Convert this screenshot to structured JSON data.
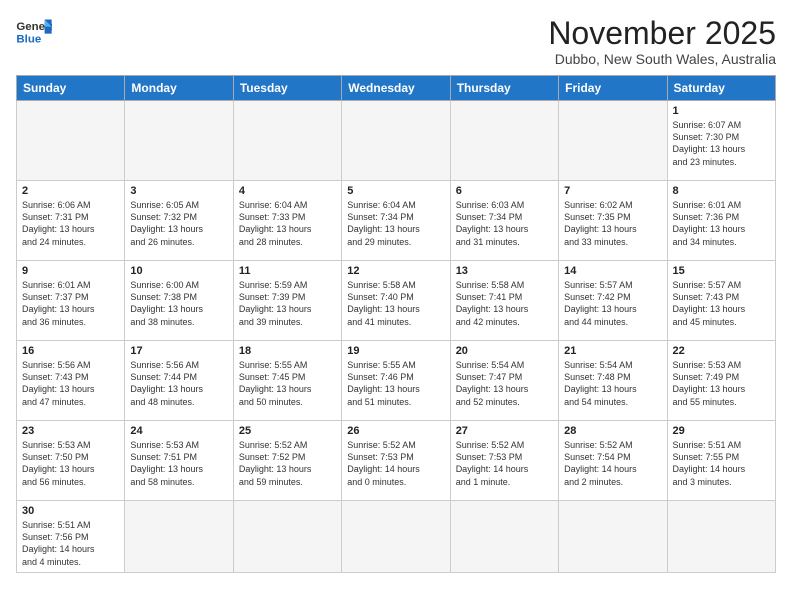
{
  "header": {
    "logo_line1": "General",
    "logo_line2": "Blue",
    "month_title": "November 2025",
    "location": "Dubbo, New South Wales, Australia"
  },
  "weekdays": [
    "Sunday",
    "Monday",
    "Tuesday",
    "Wednesday",
    "Thursday",
    "Friday",
    "Saturday"
  ],
  "weeks": [
    [
      {
        "day": "",
        "info": ""
      },
      {
        "day": "",
        "info": ""
      },
      {
        "day": "",
        "info": ""
      },
      {
        "day": "",
        "info": ""
      },
      {
        "day": "",
        "info": ""
      },
      {
        "day": "",
        "info": ""
      },
      {
        "day": "1",
        "info": "Sunrise: 6:07 AM\nSunset: 7:30 PM\nDaylight: 13 hours\nand 23 minutes."
      }
    ],
    [
      {
        "day": "2",
        "info": "Sunrise: 6:06 AM\nSunset: 7:31 PM\nDaylight: 13 hours\nand 24 minutes."
      },
      {
        "day": "3",
        "info": "Sunrise: 6:05 AM\nSunset: 7:32 PM\nDaylight: 13 hours\nand 26 minutes."
      },
      {
        "day": "4",
        "info": "Sunrise: 6:04 AM\nSunset: 7:33 PM\nDaylight: 13 hours\nand 28 minutes."
      },
      {
        "day": "5",
        "info": "Sunrise: 6:04 AM\nSunset: 7:34 PM\nDaylight: 13 hours\nand 29 minutes."
      },
      {
        "day": "6",
        "info": "Sunrise: 6:03 AM\nSunset: 7:34 PM\nDaylight: 13 hours\nand 31 minutes."
      },
      {
        "day": "7",
        "info": "Sunrise: 6:02 AM\nSunset: 7:35 PM\nDaylight: 13 hours\nand 33 minutes."
      },
      {
        "day": "8",
        "info": "Sunrise: 6:01 AM\nSunset: 7:36 PM\nDaylight: 13 hours\nand 34 minutes."
      }
    ],
    [
      {
        "day": "9",
        "info": "Sunrise: 6:01 AM\nSunset: 7:37 PM\nDaylight: 13 hours\nand 36 minutes."
      },
      {
        "day": "10",
        "info": "Sunrise: 6:00 AM\nSunset: 7:38 PM\nDaylight: 13 hours\nand 38 minutes."
      },
      {
        "day": "11",
        "info": "Sunrise: 5:59 AM\nSunset: 7:39 PM\nDaylight: 13 hours\nand 39 minutes."
      },
      {
        "day": "12",
        "info": "Sunrise: 5:58 AM\nSunset: 7:40 PM\nDaylight: 13 hours\nand 41 minutes."
      },
      {
        "day": "13",
        "info": "Sunrise: 5:58 AM\nSunset: 7:41 PM\nDaylight: 13 hours\nand 42 minutes."
      },
      {
        "day": "14",
        "info": "Sunrise: 5:57 AM\nSunset: 7:42 PM\nDaylight: 13 hours\nand 44 minutes."
      },
      {
        "day": "15",
        "info": "Sunrise: 5:57 AM\nSunset: 7:43 PM\nDaylight: 13 hours\nand 45 minutes."
      }
    ],
    [
      {
        "day": "16",
        "info": "Sunrise: 5:56 AM\nSunset: 7:43 PM\nDaylight: 13 hours\nand 47 minutes."
      },
      {
        "day": "17",
        "info": "Sunrise: 5:56 AM\nSunset: 7:44 PM\nDaylight: 13 hours\nand 48 minutes."
      },
      {
        "day": "18",
        "info": "Sunrise: 5:55 AM\nSunset: 7:45 PM\nDaylight: 13 hours\nand 50 minutes."
      },
      {
        "day": "19",
        "info": "Sunrise: 5:55 AM\nSunset: 7:46 PM\nDaylight: 13 hours\nand 51 minutes."
      },
      {
        "day": "20",
        "info": "Sunrise: 5:54 AM\nSunset: 7:47 PM\nDaylight: 13 hours\nand 52 minutes."
      },
      {
        "day": "21",
        "info": "Sunrise: 5:54 AM\nSunset: 7:48 PM\nDaylight: 13 hours\nand 54 minutes."
      },
      {
        "day": "22",
        "info": "Sunrise: 5:53 AM\nSunset: 7:49 PM\nDaylight: 13 hours\nand 55 minutes."
      }
    ],
    [
      {
        "day": "23",
        "info": "Sunrise: 5:53 AM\nSunset: 7:50 PM\nDaylight: 13 hours\nand 56 minutes."
      },
      {
        "day": "24",
        "info": "Sunrise: 5:53 AM\nSunset: 7:51 PM\nDaylight: 13 hours\nand 58 minutes."
      },
      {
        "day": "25",
        "info": "Sunrise: 5:52 AM\nSunset: 7:52 PM\nDaylight: 13 hours\nand 59 minutes."
      },
      {
        "day": "26",
        "info": "Sunrise: 5:52 AM\nSunset: 7:53 PM\nDaylight: 14 hours\nand 0 minutes."
      },
      {
        "day": "27",
        "info": "Sunrise: 5:52 AM\nSunset: 7:53 PM\nDaylight: 14 hours\nand 1 minute."
      },
      {
        "day": "28",
        "info": "Sunrise: 5:52 AM\nSunset: 7:54 PM\nDaylight: 14 hours\nand 2 minutes."
      },
      {
        "day": "29",
        "info": "Sunrise: 5:51 AM\nSunset: 7:55 PM\nDaylight: 14 hours\nand 3 minutes."
      }
    ],
    [
      {
        "day": "30",
        "info": "Sunrise: 5:51 AM\nSunset: 7:56 PM\nDaylight: 14 hours\nand 4 minutes."
      },
      {
        "day": "",
        "info": ""
      },
      {
        "day": "",
        "info": ""
      },
      {
        "day": "",
        "info": ""
      },
      {
        "day": "",
        "info": ""
      },
      {
        "day": "",
        "info": ""
      },
      {
        "day": "",
        "info": ""
      }
    ]
  ]
}
